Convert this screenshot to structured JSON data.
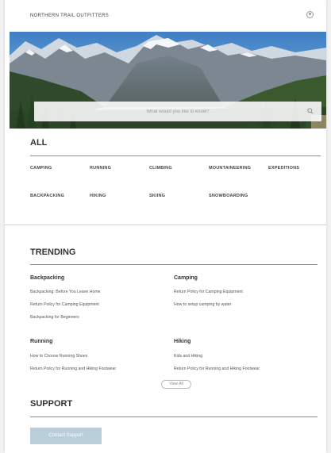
{
  "header": {
    "brand": "NORTHERN TRAIL OUTFITTERS",
    "user_icon": "user-icon"
  },
  "search": {
    "placeholder": "What would you like to know?",
    "icon": "search-icon"
  },
  "categories": {
    "title": "ALL",
    "items": [
      "CAMPING",
      "RUNNING",
      "CLIMBING",
      "MOUNTAINEERING",
      "EXPEDITIONS",
      "BACKPACKING",
      "HIKING",
      "SKIING",
      "SNOWBOARDING"
    ]
  },
  "trending": {
    "title": "TRENDING",
    "groups": [
      {
        "title": "Backpacking",
        "links": [
          "Backpacking: Before You Leave Home",
          "Return Policy for Camping Equipment",
          "Backpacking for Beginners"
        ]
      },
      {
        "title": "Camping",
        "links": [
          "Return Policy for Camping Equipment",
          "How to setup camping by water"
        ]
      },
      {
        "title": "Running",
        "links": [
          "How to Choose Running Shoes",
          "Return Policy for Running and Hiking Footwear"
        ]
      },
      {
        "title": "Hiking",
        "links": [
          "Kids and Hiking",
          "Return Policy for Running and Hiking Footwear"
        ]
      }
    ],
    "view_all": "View All"
  },
  "support": {
    "title": "SUPPORT",
    "button": "Contact Support"
  },
  "colors": {
    "button_bg": "#b8cfd9",
    "rule": "#8a8a8a"
  }
}
